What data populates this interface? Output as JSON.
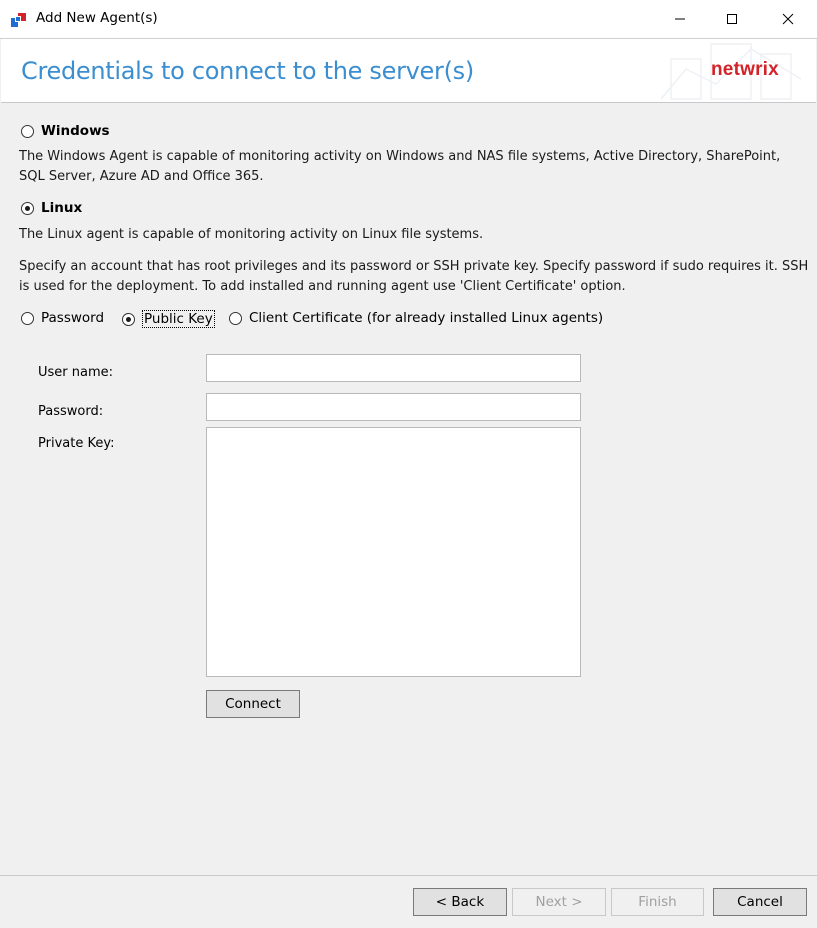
{
  "window": {
    "title": "Add New Agent(s)",
    "controls": [
      "minimize",
      "maximize",
      "close"
    ]
  },
  "header": {
    "title": "Credentials to connect to the server(s)",
    "brand": "netwrix",
    "brand_color": "#d2232a",
    "title_color": "#3b8ed0"
  },
  "agent_type": {
    "windows": {
      "label": "Windows",
      "selected": false,
      "description": "The Windows Agent is capable of monitoring activity on Windows and NAS file systems, Active Directory, SharePoint, SQL Server, Azure AD and Office 365."
    },
    "linux": {
      "label": "Linux",
      "selected": true,
      "description": "The Linux agent is capable of monitoring activity on Linux file systems."
    }
  },
  "instructions": "Specify an account that has root privileges and its password or SSH private key. Specify password if sudo requires it. SSH is used for the deployment. To add installed and running agent use 'Client Certificate' option.",
  "auth_method": {
    "options": [
      {
        "label": "Password",
        "selected": false
      },
      {
        "label": "Public Key",
        "selected": true
      },
      {
        "label": "Client Certificate (for already installed Linux agents)",
        "selected": false
      }
    ]
  },
  "form": {
    "username_label": "User name:",
    "username_value": "",
    "password_label": "Password:",
    "password_value": "",
    "private_key_label": "Private Key:",
    "private_key_value": "",
    "connect_label": "Connect"
  },
  "footer": {
    "back_label": "< Back",
    "next_label": "Next >",
    "finish_label": "Finish",
    "cancel_label": "Cancel"
  }
}
